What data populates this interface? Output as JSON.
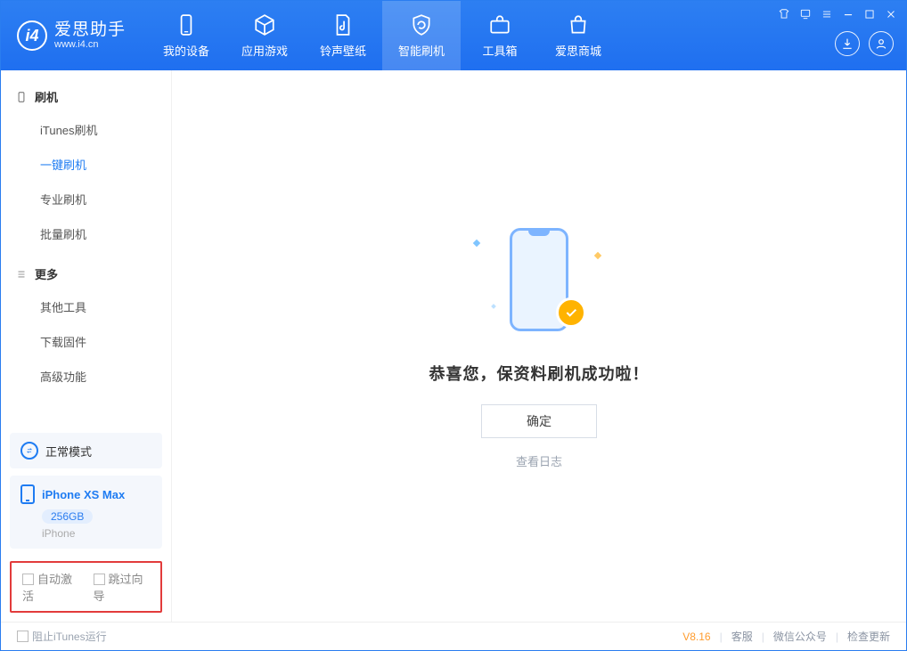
{
  "brand": {
    "cn": "爱思助手",
    "en": "www.i4.cn"
  },
  "nav": {
    "device": "我的设备",
    "apps": "应用游戏",
    "ringtone": "铃声壁纸",
    "flash": "智能刷机",
    "toolbox": "工具箱",
    "store": "爱思商城"
  },
  "sidebar": {
    "group1_title": "刷机",
    "itunes_flash": "iTunes刷机",
    "onekey_flash": "一键刷机",
    "pro_flash": "专业刷机",
    "batch_flash": "批量刷机",
    "group2_title": "更多",
    "other_tools": "其他工具",
    "download_fw": "下载固件",
    "advanced": "高级功能"
  },
  "mode_card": {
    "label": "正常模式"
  },
  "device_card": {
    "name": "iPhone XS Max",
    "capacity": "256GB",
    "subtype": "iPhone"
  },
  "options": {
    "auto_activate": "自动激活",
    "skip_guide": "跳过向导"
  },
  "main": {
    "headline": "恭喜您，保资料刷机成功啦！",
    "confirm": "确定",
    "view_log": "查看日志"
  },
  "footer": {
    "block_itunes": "阻止iTunes运行",
    "version": "V8.16",
    "support": "客服",
    "wechat": "微信公众号",
    "update": "检查更新"
  }
}
